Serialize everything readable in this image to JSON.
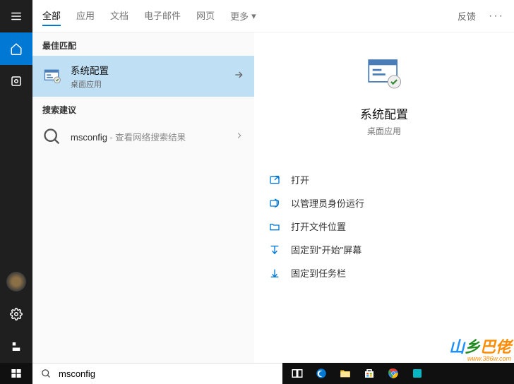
{
  "header": {
    "tabs": [
      "全部",
      "应用",
      "文档",
      "电子邮件",
      "网页",
      "更多"
    ],
    "feedback": "反馈"
  },
  "sections": {
    "best_match": "最佳匹配",
    "suggestions": "搜索建议"
  },
  "best": {
    "title": "系统配置",
    "subtitle": "桌面应用"
  },
  "suggestion": {
    "term": "msconfig",
    "hint": " - 查看网络搜索结果"
  },
  "detail": {
    "title": "系统配置",
    "subtitle": "桌面应用",
    "actions": [
      "打开",
      "以管理员身份运行",
      "打开文件位置",
      "固定到\"开始\"屏幕",
      "固定到任务栏"
    ]
  },
  "search": {
    "value": "msconfig"
  },
  "watermark": {
    "brand": "乡巴佬",
    "url": "www.386w.com"
  }
}
